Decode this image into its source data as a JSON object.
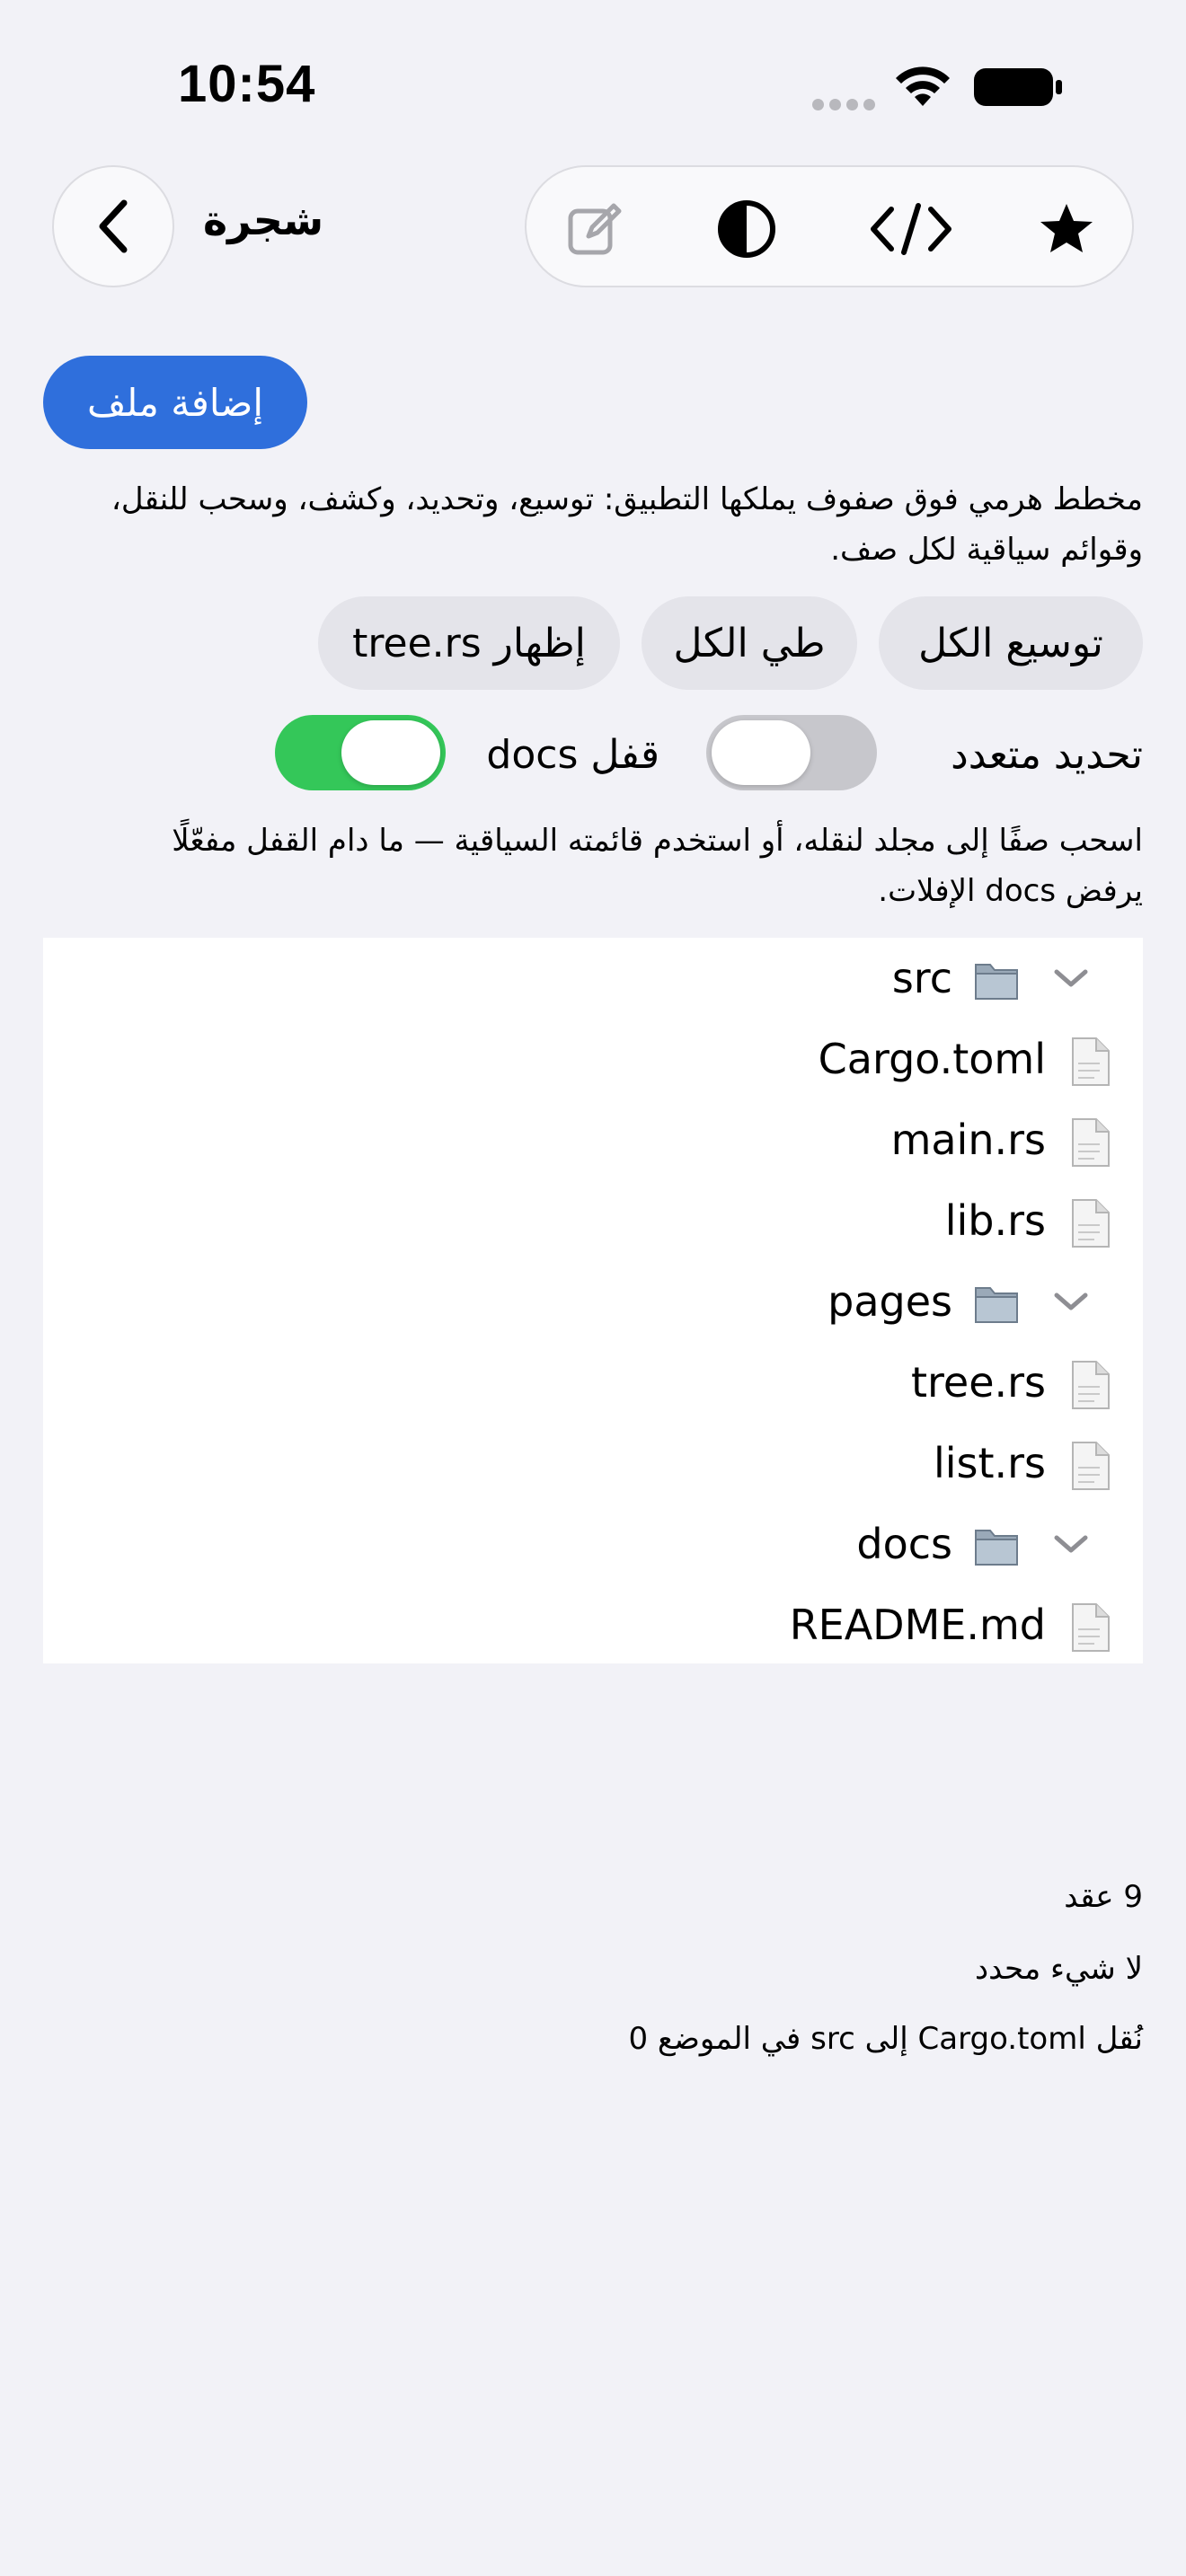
{
  "status_bar": {
    "time": "10:54"
  },
  "nav": {
    "back_icon": "chevron-left-icon",
    "title": "شجرة",
    "toolbar_icons": [
      "compose-icon",
      "contrast-icon",
      "code-icon",
      "star-icon"
    ]
  },
  "actions": {
    "add_file": "إضافة ملف"
  },
  "description": "مخطط هرمي فوق صفوف يملكها التطبيق: توسيع، وتحديد، وكشف، وسحب للنقل، وقوائم سياقية لكل صف.",
  "buttons": {
    "expand_all": "توسيع الكل",
    "collapse_all": "طي الكل",
    "reveal": "إظهار tree.rs"
  },
  "toggles": {
    "multi_select": {
      "label": "تحديد متعدد",
      "on": false
    },
    "lock_docs": {
      "label": "قفل docs",
      "on": true
    }
  },
  "hint": "اسحب صفًا إلى مجلد لنقله، أو استخدم قائمته السياقية — ما دام القفل مفعّلًا يرفض docs الإفلات.",
  "tree": {
    "rows": [
      {
        "label": "src",
        "type": "folder",
        "expanded": true
      },
      {
        "label": "Cargo.toml",
        "type": "file"
      },
      {
        "label": "main.rs",
        "type": "file"
      },
      {
        "label": "lib.rs",
        "type": "file"
      },
      {
        "label": "pages",
        "type": "folder",
        "expanded": true
      },
      {
        "label": "tree.rs",
        "type": "file"
      },
      {
        "label": "list.rs",
        "type": "file"
      },
      {
        "label": "docs",
        "type": "folder",
        "expanded": true
      },
      {
        "label": "README.md",
        "type": "file"
      }
    ]
  },
  "footer": {
    "node_count": "9 عقد",
    "selection": "لا شيء محدد",
    "last_move": "نُقل Cargo.toml إلى src في الموضع 0"
  },
  "colors": {
    "background": "#f2f2f7",
    "accent": "#2f6fdc",
    "toggle_on": "#34c759",
    "toggle_off": "#c7c7cc",
    "pill": "#e4e4ea"
  }
}
